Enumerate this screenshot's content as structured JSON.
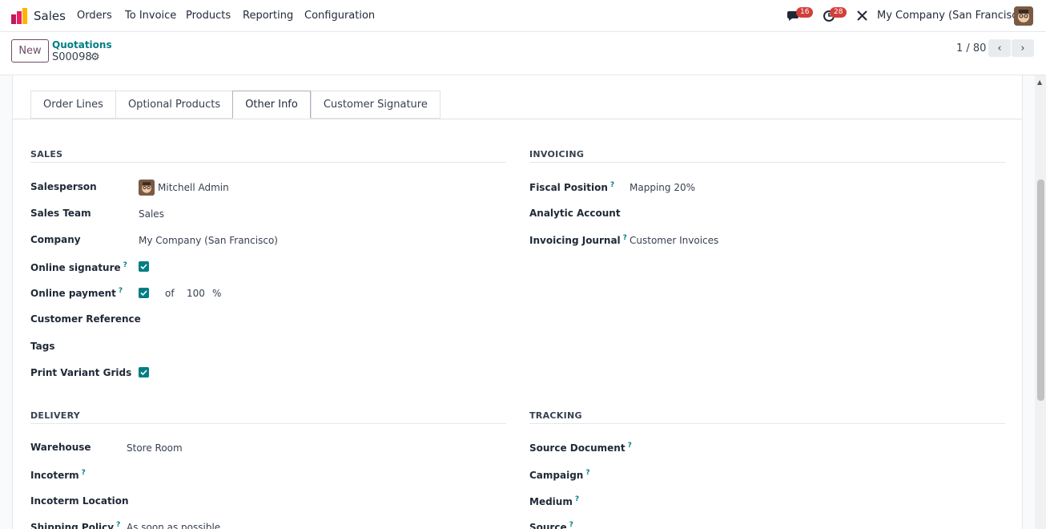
{
  "nav": {
    "app_name": "Sales",
    "menu": [
      "Orders",
      "To Invoice",
      "Products",
      "Reporting",
      "Configuration"
    ],
    "messages_badge": "16",
    "activities_badge": "28",
    "company": "My Company (San Francisco)"
  },
  "control": {
    "new_label": "New",
    "breadcrumb": "Quotations",
    "record": "S00098",
    "pager": "1 / 80"
  },
  "tabs": [
    {
      "label": "Order Lines"
    },
    {
      "label": "Optional Products"
    },
    {
      "label": "Other Info",
      "active": true
    },
    {
      "label": "Customer Signature"
    }
  ],
  "sales": {
    "title": "SALES",
    "salesperson_label": "Salesperson",
    "salesperson": "Mitchell Admin",
    "team_label": "Sales Team",
    "team": "Sales",
    "company_label": "Company",
    "company": "My Company (San Francisco)",
    "online_signature_label": "Online signature",
    "online_signature": true,
    "online_payment_label": "Online payment",
    "online_payment": true,
    "payment_of": "of",
    "payment_percent": "100",
    "payment_percent_sign": "%",
    "customer_ref_label": "Customer Reference",
    "tags_label": "Tags",
    "print_variant_label": "Print Variant Grids",
    "print_variant": true
  },
  "invoicing": {
    "title": "INVOICING",
    "fiscal_position_label": "Fiscal Position",
    "fiscal_position": "Mapping 20%",
    "analytic_label": "Analytic Account",
    "journal_label": "Invoicing Journal",
    "journal": "Customer Invoices"
  },
  "delivery": {
    "title": "DELIVERY",
    "warehouse_label": "Warehouse",
    "warehouse": "Store Room",
    "incoterm_label": "Incoterm",
    "incoterm_location_label": "Incoterm Location",
    "shipping_policy_label": "Shipping Policy",
    "shipping_policy": "As soon as possible"
  },
  "tracking": {
    "title": "TRACKING",
    "source_document_label": "Source Document",
    "campaign_label": "Campaign",
    "medium_label": "Medium",
    "source_label": "Source"
  },
  "help_mark": "?",
  "colors": {
    "brand": "#714b67",
    "accent": "#017e84",
    "badge": "#d23f3a"
  },
  "icons": [
    "app-logo-icon",
    "chat-icon",
    "clock-icon",
    "debug-tools-icon",
    "gear-icon",
    "chevron-left-icon",
    "chevron-right-icon",
    "checkbox-checked-icon"
  ]
}
